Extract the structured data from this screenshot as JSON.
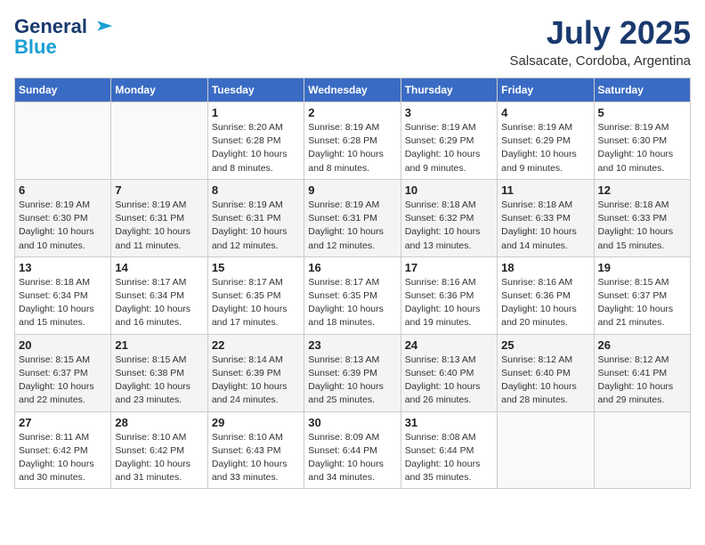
{
  "header": {
    "logo_line1": "General",
    "logo_line2": "Blue",
    "month": "July 2025",
    "location": "Salsacate, Cordoba, Argentina"
  },
  "weekdays": [
    "Sunday",
    "Monday",
    "Tuesday",
    "Wednesday",
    "Thursday",
    "Friday",
    "Saturday"
  ],
  "weeks": [
    [
      {
        "num": "",
        "detail": ""
      },
      {
        "num": "",
        "detail": ""
      },
      {
        "num": "1",
        "detail": "Sunrise: 8:20 AM\nSunset: 6:28 PM\nDaylight: 10 hours and 8 minutes."
      },
      {
        "num": "2",
        "detail": "Sunrise: 8:19 AM\nSunset: 6:28 PM\nDaylight: 10 hours and 8 minutes."
      },
      {
        "num": "3",
        "detail": "Sunrise: 8:19 AM\nSunset: 6:29 PM\nDaylight: 10 hours and 9 minutes."
      },
      {
        "num": "4",
        "detail": "Sunrise: 8:19 AM\nSunset: 6:29 PM\nDaylight: 10 hours and 9 minutes."
      },
      {
        "num": "5",
        "detail": "Sunrise: 8:19 AM\nSunset: 6:30 PM\nDaylight: 10 hours and 10 minutes."
      }
    ],
    [
      {
        "num": "6",
        "detail": "Sunrise: 8:19 AM\nSunset: 6:30 PM\nDaylight: 10 hours and 10 minutes."
      },
      {
        "num": "7",
        "detail": "Sunrise: 8:19 AM\nSunset: 6:31 PM\nDaylight: 10 hours and 11 minutes."
      },
      {
        "num": "8",
        "detail": "Sunrise: 8:19 AM\nSunset: 6:31 PM\nDaylight: 10 hours and 12 minutes."
      },
      {
        "num": "9",
        "detail": "Sunrise: 8:19 AM\nSunset: 6:31 PM\nDaylight: 10 hours and 12 minutes."
      },
      {
        "num": "10",
        "detail": "Sunrise: 8:18 AM\nSunset: 6:32 PM\nDaylight: 10 hours and 13 minutes."
      },
      {
        "num": "11",
        "detail": "Sunrise: 8:18 AM\nSunset: 6:33 PM\nDaylight: 10 hours and 14 minutes."
      },
      {
        "num": "12",
        "detail": "Sunrise: 8:18 AM\nSunset: 6:33 PM\nDaylight: 10 hours and 15 minutes."
      }
    ],
    [
      {
        "num": "13",
        "detail": "Sunrise: 8:18 AM\nSunset: 6:34 PM\nDaylight: 10 hours and 15 minutes."
      },
      {
        "num": "14",
        "detail": "Sunrise: 8:17 AM\nSunset: 6:34 PM\nDaylight: 10 hours and 16 minutes."
      },
      {
        "num": "15",
        "detail": "Sunrise: 8:17 AM\nSunset: 6:35 PM\nDaylight: 10 hours and 17 minutes."
      },
      {
        "num": "16",
        "detail": "Sunrise: 8:17 AM\nSunset: 6:35 PM\nDaylight: 10 hours and 18 minutes."
      },
      {
        "num": "17",
        "detail": "Sunrise: 8:16 AM\nSunset: 6:36 PM\nDaylight: 10 hours and 19 minutes."
      },
      {
        "num": "18",
        "detail": "Sunrise: 8:16 AM\nSunset: 6:36 PM\nDaylight: 10 hours and 20 minutes."
      },
      {
        "num": "19",
        "detail": "Sunrise: 8:15 AM\nSunset: 6:37 PM\nDaylight: 10 hours and 21 minutes."
      }
    ],
    [
      {
        "num": "20",
        "detail": "Sunrise: 8:15 AM\nSunset: 6:37 PM\nDaylight: 10 hours and 22 minutes."
      },
      {
        "num": "21",
        "detail": "Sunrise: 8:15 AM\nSunset: 6:38 PM\nDaylight: 10 hours and 23 minutes."
      },
      {
        "num": "22",
        "detail": "Sunrise: 8:14 AM\nSunset: 6:39 PM\nDaylight: 10 hours and 24 minutes."
      },
      {
        "num": "23",
        "detail": "Sunrise: 8:13 AM\nSunset: 6:39 PM\nDaylight: 10 hours and 25 minutes."
      },
      {
        "num": "24",
        "detail": "Sunrise: 8:13 AM\nSunset: 6:40 PM\nDaylight: 10 hours and 26 minutes."
      },
      {
        "num": "25",
        "detail": "Sunrise: 8:12 AM\nSunset: 6:40 PM\nDaylight: 10 hours and 28 minutes."
      },
      {
        "num": "26",
        "detail": "Sunrise: 8:12 AM\nSunset: 6:41 PM\nDaylight: 10 hours and 29 minutes."
      }
    ],
    [
      {
        "num": "27",
        "detail": "Sunrise: 8:11 AM\nSunset: 6:42 PM\nDaylight: 10 hours and 30 minutes."
      },
      {
        "num": "28",
        "detail": "Sunrise: 8:10 AM\nSunset: 6:42 PM\nDaylight: 10 hours and 31 minutes."
      },
      {
        "num": "29",
        "detail": "Sunrise: 8:10 AM\nSunset: 6:43 PM\nDaylight: 10 hours and 33 minutes."
      },
      {
        "num": "30",
        "detail": "Sunrise: 8:09 AM\nSunset: 6:44 PM\nDaylight: 10 hours and 34 minutes."
      },
      {
        "num": "31",
        "detail": "Sunrise: 8:08 AM\nSunset: 6:44 PM\nDaylight: 10 hours and 35 minutes."
      },
      {
        "num": "",
        "detail": ""
      },
      {
        "num": "",
        "detail": ""
      }
    ]
  ]
}
